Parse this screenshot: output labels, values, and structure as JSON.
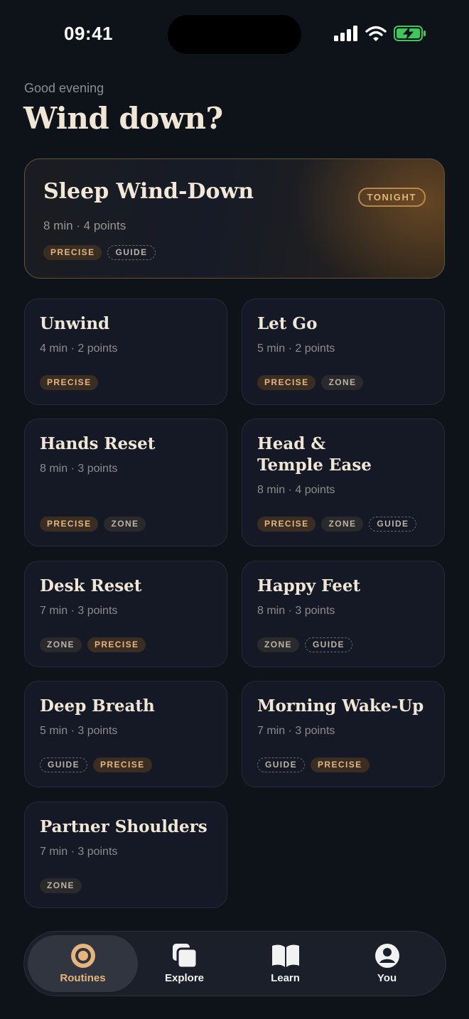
{
  "status": {
    "time": "09:41"
  },
  "header": {
    "greeting": "Good evening",
    "headline": "Wind down?"
  },
  "featured": {
    "title": "Sleep Wind-Down",
    "meta": "8 min · 4 points",
    "badge": "TONIGHT",
    "tags": [
      "PRECISE",
      "GUIDE"
    ]
  },
  "routines": [
    {
      "title": "Unwind",
      "meta": "4 min · 2 points",
      "tags": [
        "PRECISE"
      ]
    },
    {
      "title": "Let Go",
      "meta": "5 min · 2 points",
      "tags": [
        "PRECISE",
        "ZONE"
      ]
    },
    {
      "title": "Hands Reset",
      "meta": "8 min · 3 points",
      "tags": [
        "PRECISE",
        "ZONE"
      ]
    },
    {
      "title_line1": "Head &",
      "title_line2": "Temple Ease",
      "meta": "8 min · 4 points",
      "tags": [
        "PRECISE",
        "ZONE",
        "GUIDE"
      ]
    },
    {
      "title": "Desk Reset",
      "meta": "7 min · 3 points",
      "tags": [
        "ZONE",
        "PRECISE"
      ]
    },
    {
      "title": "Happy Feet",
      "meta": "8 min · 3 points",
      "tags": [
        "ZONE",
        "GUIDE"
      ]
    },
    {
      "title": "Deep Breath",
      "meta": "5 min · 3 points",
      "tags": [
        "GUIDE",
        "PRECISE"
      ]
    },
    {
      "title": "Morning Wake-Up",
      "meta": "7 min · 3 points",
      "tags": [
        "GUIDE",
        "PRECISE"
      ]
    },
    {
      "title": "Partner Shoulders",
      "meta": "7 min · 3 points",
      "tags": [
        "ZONE"
      ]
    }
  ],
  "tabs": [
    {
      "label": "Routines",
      "icon": "target-icon",
      "active": true
    },
    {
      "label": "Explore",
      "icon": "stacked-cards-icon",
      "active": false
    },
    {
      "label": "Learn",
      "icon": "open-book-icon",
      "active": false
    },
    {
      "label": "You",
      "icon": "person-icon",
      "active": false
    }
  ],
  "colors": {
    "accent": "#e7b57b",
    "background": "#0e1219",
    "card": "#151925"
  }
}
